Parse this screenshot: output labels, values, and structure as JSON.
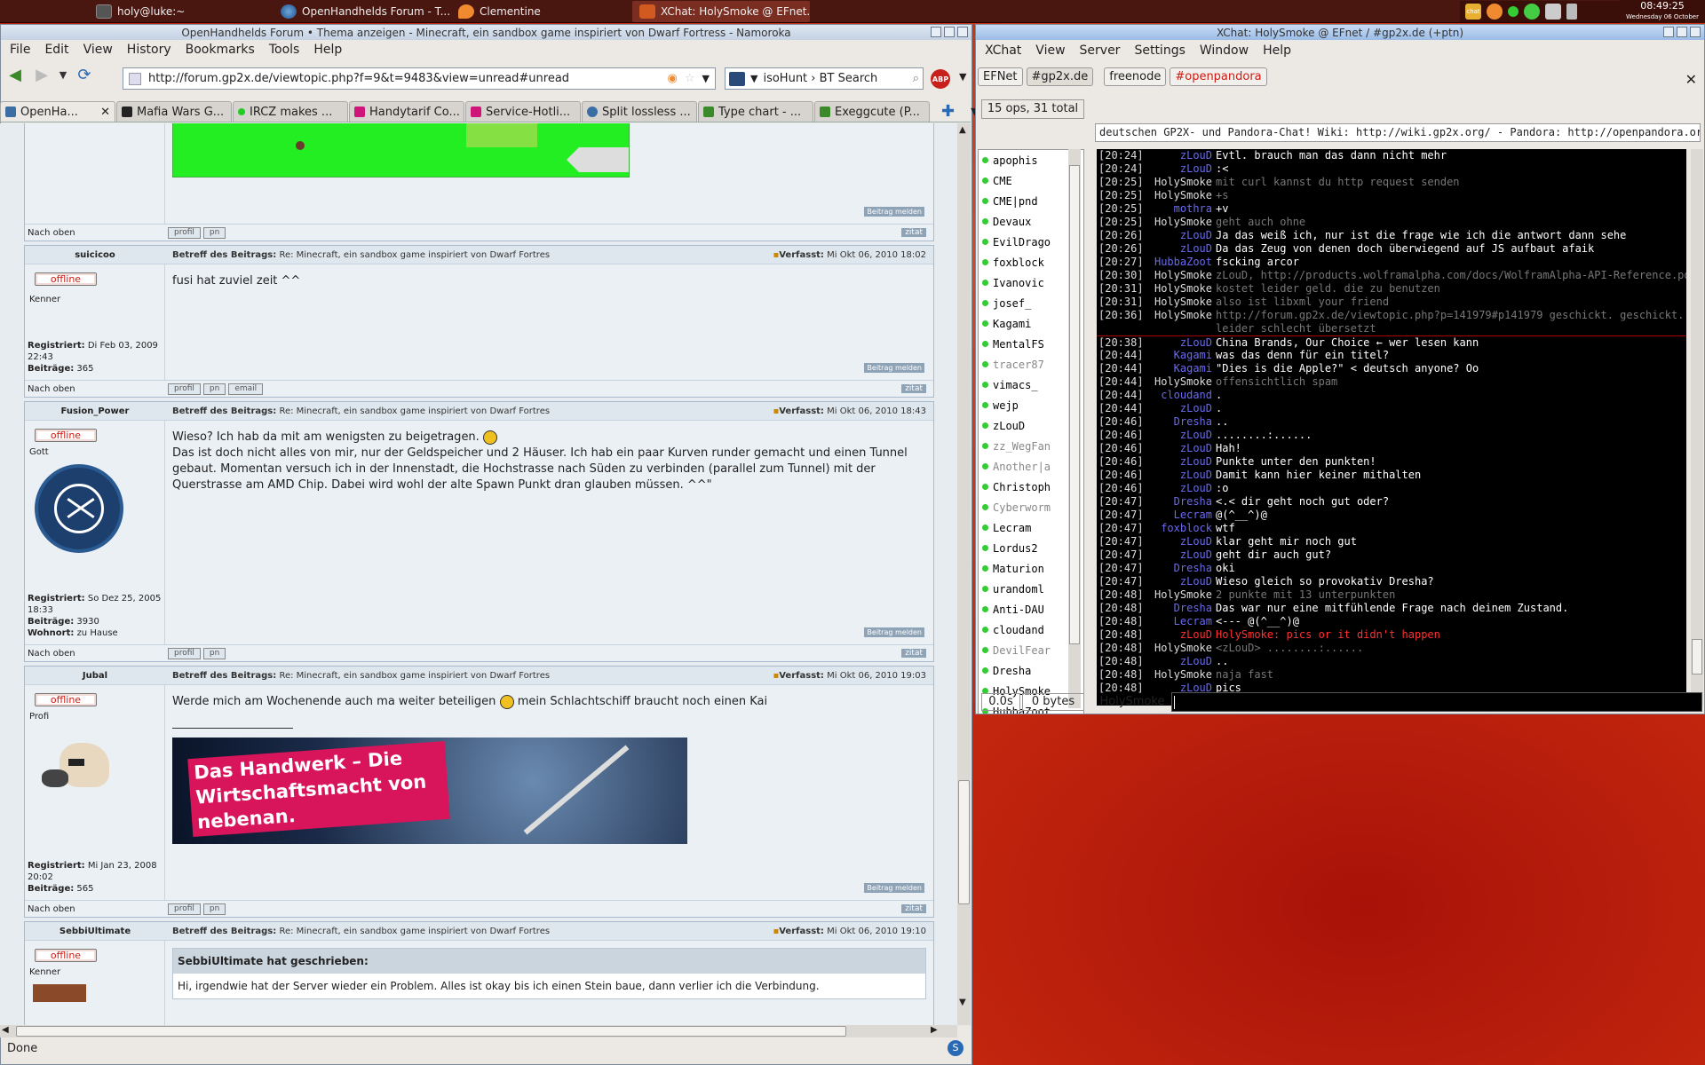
{
  "taskbar": {
    "tasks": [
      {
        "label": "holy@luke:~",
        "color": "#555"
      },
      {
        "label": "OpenHandhelds Forum - T...",
        "color": "#3a6ea5"
      },
      {
        "label": "Clementine",
        "color": "#f08a30"
      },
      {
        "label": "XChat: HolySmoke @ EFnet...",
        "color": "#d05a20"
      }
    ],
    "tray_label": "chat",
    "clock_time": "08:49:25",
    "clock_date": "Wednesday 06 October"
  },
  "browser": {
    "title": "OpenHandhelds Forum • Thema anzeigen - Minecraft, ein sandbox game inspiriert von Dwarf Fortress - Namoroka",
    "menu": [
      "File",
      "Edit",
      "View",
      "History",
      "Bookmarks",
      "Tools",
      "Help"
    ],
    "url": "http://forum.gp2x.de/viewtopic.php?f=9&t=9483&view=unread#unread",
    "search_engine": "isoHunt › BT Search",
    "abp_label": "ABP",
    "tabs": [
      {
        "label": "OpenHa...",
        "color": "#3a6ea5"
      },
      {
        "label": "Mafia Wars G...",
        "color": "#222"
      },
      {
        "label": "IRCZ makes ...",
        "color": "#2c2"
      },
      {
        "label": "Handytarif Co...",
        "color": "#d0157a"
      },
      {
        "label": "Service-Hotli...",
        "color": "#d0157a"
      },
      {
        "label": "Split lossless ...",
        "color": "#3a6ea5"
      },
      {
        "label": "Type chart - ...",
        "color": "#3a8a2a"
      },
      {
        "label": "Exeggcute (P...",
        "color": "#3a8a2a"
      }
    ],
    "status": "Done",
    "status_icon": "S"
  },
  "forum": {
    "nach_oben": "Nach oben",
    "melden": "Beitrag melden",
    "zitat": "zitat",
    "offline": "offline",
    "subj_prefix": "Betreff des Beitrags:",
    "subj": "Re: Minecraft, ein sandbox game inspiriert von Dwarf Fortres",
    "date_prefix": "Verfasst:",
    "btn_profil": "profil",
    "btn_pn": "pn",
    "btn_email": "email",
    "lbl_registriert": "Registriert:",
    "lbl_beitraege": "Beiträge:",
    "lbl_wohnort": "Wohnort:",
    "posts": [
      {
        "author": "suicicoo",
        "date": "Mi Okt 06, 2010 18:02",
        "rank": "Kenner",
        "reg": "Di Feb 03, 2009 22:43",
        "beitraege": "365",
        "text": "fusi hat zuviel zeit ^^"
      },
      {
        "author": "Fusion_Power",
        "date": "Mi Okt 06, 2010 18:43",
        "rank": "Gott",
        "reg": "So Dez 25, 2005 18:33",
        "beitraege": "3930",
        "wohnort": "zu Hause",
        "text": "Wieso? Ich hab da mit am wenigsten zu beigetragen.",
        "text2": "Das ist doch nicht alles von mir, nur der Geldspeicher und 2 Häuser. Ich hab ein paar Kurven runder gemacht und einen Tunnel gebaut. Momentan versuch ich in der Innenstadt, die Hochstrasse nach Süden zu verbinden (parallel zum Tunnel) mit der Querstrasse am AMD Chip. Dabei wird wohl der alte Spawn Punkt dran glauben müssen. ^^\""
      },
      {
        "author": "Jubal",
        "date": "Mi Okt 06, 2010 19:03",
        "rank": "Profi",
        "reg": "Mi Jan 23, 2008 20:02",
        "beitraege": "565",
        "text": "Werde mich am Wochenende auch ma weiter beteiligen",
        "text_after": "mein Schlachtschiff braucht noch einen Kai",
        "banner": "Das Handwerk – Die Wirtschaftsmacht von nebenan."
      },
      {
        "author": "SebbiUltimate",
        "date": "Mi Okt 06, 2010 19:10",
        "rank": "Kenner",
        "quote_head": "SebbiUltimate hat geschrieben:",
        "quote_body": "Hi, irgendwie hat der Server wieder ein Problem. Alles ist okay bis ich einen Stein baue, dann verlier ich die Verbindung."
      }
    ]
  },
  "xchat": {
    "title": "XChat: HolySmoke @ EFnet / #gp2x.de (+ptn)",
    "menu": [
      "XChat",
      "View",
      "Server",
      "Settings",
      "Window",
      "Help"
    ],
    "tabs": [
      "EFNet",
      "#gp2x.de",
      "freenode",
      "#openpandora"
    ],
    "ops": "15 ops, 31 total",
    "topic": "deutschen GP2X- und Pandora-Chat! Wiki: http://wiki.gp2x.org/ - Pandora: http://openpandora.org/",
    "lag": "0.0s",
    "bytes": "0 bytes",
    "me": "HolySmoke",
    "nicks": [
      {
        "n": "apophis",
        "c": "#000"
      },
      {
        "n": "CME",
        "c": "#000"
      },
      {
        "n": "CME|pnd",
        "c": "#000"
      },
      {
        "n": "Devaux",
        "c": "#000"
      },
      {
        "n": "EvilDrago",
        "c": "#000"
      },
      {
        "n": "foxblock",
        "c": "#000"
      },
      {
        "n": "Ivanovic",
        "c": "#000"
      },
      {
        "n": "josef_",
        "c": "#000"
      },
      {
        "n": "Kagami",
        "c": "#000"
      },
      {
        "n": "MentalFS",
        "c": "#000"
      },
      {
        "n": "tracer87",
        "c": "#888"
      },
      {
        "n": "vimacs_",
        "c": "#000"
      },
      {
        "n": "wejp",
        "c": "#000"
      },
      {
        "n": "zLouD",
        "c": "#000"
      },
      {
        "n": "zz_WegFan",
        "c": "#888"
      },
      {
        "n": "Another|a",
        "c": "#888"
      },
      {
        "n": "Christoph",
        "c": "#000"
      },
      {
        "n": "Cyberworm",
        "c": "#888"
      },
      {
        "n": "Lecram",
        "c": "#000"
      },
      {
        "n": "Lordus2",
        "c": "#000"
      },
      {
        "n": "Maturion",
        "c": "#000"
      },
      {
        "n": "urandoml",
        "c": "#000"
      },
      {
        "n": "Anti-DAU",
        "c": "#000"
      },
      {
        "n": "cloudand",
        "c": "#000"
      },
      {
        "n": "DevilFear",
        "c": "#888"
      },
      {
        "n": "Dresha",
        "c": "#000"
      },
      {
        "n": "HolySmoke",
        "c": "#000"
      },
      {
        "n": "HubbaZoot",
        "c": "#000"
      }
    ],
    "log": [
      {
        "t": "[20:24]",
        "n": "zLouD",
        "nc": "#6a6af0",
        "m": "Evtl. brauch man das dann nicht mehr",
        "mc": "#fff"
      },
      {
        "t": "[20:24]",
        "n": "zLouD",
        "nc": "#6a6af0",
        "m": ":<",
        "mc": "#fff"
      },
      {
        "t": "[20:25]",
        "n": "HolySmoke",
        "nc": "#ddd",
        "m": "mit curl kannst du http request senden",
        "mc": "#777"
      },
      {
        "t": "[20:25]",
        "n": "HolySmoke",
        "nc": "#ddd",
        "m": "+s",
        "mc": "#777"
      },
      {
        "t": "[20:25]",
        "n": "mothra",
        "nc": "#6a6af0",
        "m": "+v",
        "mc": "#fff"
      },
      {
        "t": "[20:25]",
        "n": "HolySmoke",
        "nc": "#ddd",
        "m": "geht auch ohne",
        "mc": "#777"
      },
      {
        "t": "[20:26]",
        "n": "zLouD",
        "nc": "#6a6af0",
        "m": "Ja das weiß ich, nur ist die frage wie ich die antwort dann sehe",
        "mc": "#fff"
      },
      {
        "t": "[20:26]",
        "n": "zLouD",
        "nc": "#6a6af0",
        "m": "Da das Zeug von denen doch überwiegend auf JS aufbaut afaik",
        "mc": "#fff"
      },
      {
        "t": "[20:27]",
        "n": "HubbaZoot",
        "nc": "#6a6af0",
        "m": "fscking arcor",
        "mc": "#fff"
      },
      {
        "t": "[20:30]",
        "n": "HolySmoke",
        "nc": "#ddd",
        "m": "zLouD, http://products.wolframalpha.com/docs/WolframAlpha-API-Reference.pdf",
        "mc": "#777"
      },
      {
        "t": "[20:31]",
        "n": "HolySmoke",
        "nc": "#ddd",
        "m": "kostet leider geld. die zu benutzen",
        "mc": "#777"
      },
      {
        "t": "[20:31]",
        "n": "HolySmoke",
        "nc": "#ddd",
        "m": "also ist libxml your friend",
        "mc": "#777"
      },
      {
        "t": "[20:36]",
        "n": "HolySmoke",
        "nc": "#ddd",
        "m": "http://forum.gp2x.de/viewtopic.php?p=141979#p141979 geschickt. geschickt.",
        "mc": "#777"
      },
      {
        "t": "",
        "n": "",
        "nc": "#ddd",
        "m": "leider schlecht übersetzt",
        "mc": "#777"
      },
      {
        "t": "[20:38]",
        "n": "zLouD",
        "nc": "#6a6af0",
        "m": "China Brands, Our Choice ← wer lesen kann",
        "mc": "#fff",
        "sep": true
      },
      {
        "t": "[20:44]",
        "n": "Kagami",
        "nc": "#6a6af0",
        "m": "was das denn für ein titel?",
        "mc": "#fff"
      },
      {
        "t": "[20:44]",
        "n": "Kagami",
        "nc": "#6a6af0",
        "m": "\"Dies is die Apple?\" < deutsch anyone? Oo",
        "mc": "#fff"
      },
      {
        "t": "[20:44]",
        "n": "HolySmoke",
        "nc": "#ddd",
        "m": "offensichtlich spam",
        "mc": "#777"
      },
      {
        "t": "[20:44]",
        "n": "cloudand",
        "nc": "#6a6af0",
        "m": ".",
        "mc": "#fff"
      },
      {
        "t": "[20:44]",
        "n": "zLouD",
        "nc": "#6a6af0",
        "m": ".",
        "mc": "#fff"
      },
      {
        "t": "[20:46]",
        "n": "Dresha",
        "nc": "#6a6af0",
        "m": "..",
        "mc": "#fff"
      },
      {
        "t": "[20:46]",
        "n": "zLouD",
        "nc": "#6a6af0",
        "m": "........:......",
        "mc": "#fff"
      },
      {
        "t": "[20:46]",
        "n": "zLouD",
        "nc": "#6a6af0",
        "m": "Hah!",
        "mc": "#fff"
      },
      {
        "t": "[20:46]",
        "n": "zLouD",
        "nc": "#6a6af0",
        "m": "Punkte unter den punkten!",
        "mc": "#fff"
      },
      {
        "t": "[20:46]",
        "n": "zLouD",
        "nc": "#6a6af0",
        "m": "Damit kann hier keiner mithalten",
        "mc": "#fff"
      },
      {
        "t": "[20:46]",
        "n": "zLouD",
        "nc": "#6a6af0",
        "m": ":o",
        "mc": "#fff"
      },
      {
        "t": "[20:47]",
        "n": "Dresha",
        "nc": "#6a6af0",
        "m": "<.< dir geht noch gut oder?",
        "mc": "#fff"
      },
      {
        "t": "[20:47]",
        "n": "Lecram",
        "nc": "#6a6af0",
        "m": "@(^__^)@",
        "mc": "#fff"
      },
      {
        "t": "[20:47]",
        "n": "foxblock",
        "nc": "#6a6af0",
        "m": "wtf",
        "mc": "#fff"
      },
      {
        "t": "[20:47]",
        "n": "zLouD",
        "nc": "#6a6af0",
        "m": "klar geht mir noch gut",
        "mc": "#fff"
      },
      {
        "t": "[20:47]",
        "n": "zLouD",
        "nc": "#6a6af0",
        "m": "geht dir auch gut?",
        "mc": "#fff"
      },
      {
        "t": "[20:47]",
        "n": "Dresha",
        "nc": "#6a6af0",
        "m": "oki",
        "mc": "#fff"
      },
      {
        "t": "[20:47]",
        "n": "zLouD",
        "nc": "#6a6af0",
        "m": "Wieso gleich so provokativ Dresha?",
        "mc": "#fff"
      },
      {
        "t": "[20:48]",
        "n": "HolySmoke",
        "nc": "#ddd",
        "m": "2 punkte mit 13 unterpunkten",
        "mc": "#777"
      },
      {
        "t": "[20:48]",
        "n": "Dresha",
        "nc": "#6a6af0",
        "m": "Das war nur eine mitfühlende Frage nach deinem Zustand.",
        "mc": "#fff"
      },
      {
        "t": "[20:48]",
        "n": "Lecram",
        "nc": "#6a6af0",
        "m": "<---     @(^__^)@",
        "mc": "#fff"
      },
      {
        "t": "[20:48]",
        "n": "zLouD",
        "nc": "#ff3030",
        "m": "HolySmoke: pics or it didn't happen",
        "mc": "#ff3030"
      },
      {
        "t": "[20:48]",
        "n": "HolySmoke",
        "nc": "#ddd",
        "m": "<zLouD> ........:......",
        "mc": "#777"
      },
      {
        "t": "[20:48]",
        "n": "zLouD",
        "nc": "#6a6af0",
        "m": "..",
        "mc": "#fff"
      },
      {
        "t": "[20:48]",
        "n": "HolySmoke",
        "nc": "#ddd",
        "m": "naja fast",
        "mc": "#777"
      },
      {
        "t": "[20:48]",
        "n": "zLouD",
        "nc": "#6a6af0",
        "m": "pics",
        "mc": "#fff"
      }
    ]
  }
}
